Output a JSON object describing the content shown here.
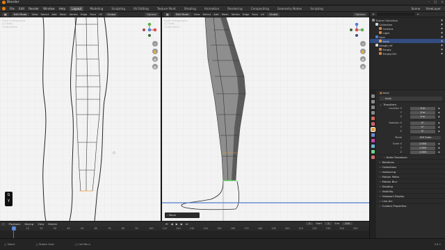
{
  "window": {
    "title": "Blender"
  },
  "menu": {
    "items": [
      "File",
      "Edit",
      "Render",
      "Window",
      "Help"
    ],
    "workspaces": [
      "Layout",
      "Modeling",
      "Sculpting",
      "UV Editing",
      "Texture Paint",
      "Shading",
      "Animation",
      "Rendering",
      "Compositing",
      "Geometry Nodes",
      "Scripting"
    ],
    "active_workspace": "Layout",
    "scene": "Scene",
    "view_layer": "ViewLayer"
  },
  "left_viewport": {
    "mode": "Edit Mode",
    "menus": [
      "View",
      "Select",
      "Add",
      "Mesh",
      "Vertex",
      "Edge",
      "Face",
      "UV"
    ],
    "orientation": "Global",
    "options": "Options",
    "info": [
      "Front Orthographic",
      "(1) body",
      "Centimeters"
    ],
    "key_overlay": [
      "G",
      "Y"
    ]
  },
  "right_viewport": {
    "mode": "Edit Mode",
    "menus": [
      "View",
      "Select",
      "Add",
      "Mesh",
      "Vertex",
      "Edge",
      "Face",
      "UV"
    ],
    "orientation": "Global",
    "options": "Options",
    "info": [
      "Right Orthographic",
      "(1) body",
      "Centimeters"
    ],
    "last_op": "Move"
  },
  "outliner": {
    "items": [
      {
        "label": "Scene Collection",
        "indent": 0,
        "color": "#8c8c8c"
      },
      {
        "label": "Collection",
        "indent": 1,
        "color": "#d8d8d8"
      },
      {
        "label": "Camera",
        "indent": 2,
        "color": "#d1894b"
      },
      {
        "label": "Light",
        "indent": 2,
        "color": "#d1894b"
      },
      {
        "label": "blue",
        "indent": 1,
        "color": "#4f7dd4"
      },
      {
        "label": "body",
        "indent": 2,
        "color": "#e6a14b",
        "selected": true
      },
      {
        "label": "image_ref",
        "indent": 1,
        "color": "#d8d8d8"
      },
      {
        "label": "Empty",
        "indent": 2,
        "color": "#d1894b"
      },
      {
        "label": "Empty.001",
        "indent": 2,
        "color": "#d1894b"
      }
    ]
  },
  "properties": {
    "object_name": "body",
    "object_name_field": "body",
    "transform_panel": "Transform",
    "location_label": "Location X",
    "rotation_label": "Rotation X",
    "scale_label": "Scale X",
    "axis_y": "Y",
    "axis_z": "Z",
    "location": [
      "0 m",
      "0 m",
      "0 m"
    ],
    "rotation": [
      "0°",
      "0°",
      "0°"
    ],
    "mode_label": "Mode",
    "mode": "XYZ Euler",
    "scale": [
      "1.000",
      "1.000",
      "1.000"
    ],
    "panels": [
      "Delta Transform",
      "Relations",
      "Collections",
      "Instancing",
      "Motion Paths",
      "Motion Blur",
      "Shading",
      "Visibility",
      "Viewport Display",
      "Line Art",
      "Custom Properties"
    ]
  },
  "timeline": {
    "menus": [
      "Playback",
      "Keying",
      "View",
      "Marker"
    ],
    "current_frame": "1",
    "start_label": "Start",
    "start": "1",
    "end_label": "End",
    "end": "250",
    "ticks": [
      "0",
      "10",
      "20",
      "30",
      "40",
      "50",
      "60",
      "70",
      "80",
      "90",
      "100",
      "110",
      "120",
      "130",
      "140",
      "150",
      "160",
      "170",
      "180",
      "190",
      "200",
      "210",
      "220",
      "230",
      "240",
      "250"
    ]
  },
  "statusbar": {
    "items": [
      "Select",
      "Rotate View",
      "Call Menu"
    ],
    "version": "3.4.1"
  },
  "colors": {
    "accent": "#e87d0d",
    "selection": "#334d80",
    "frame_marker": "#4d7ccc"
  }
}
